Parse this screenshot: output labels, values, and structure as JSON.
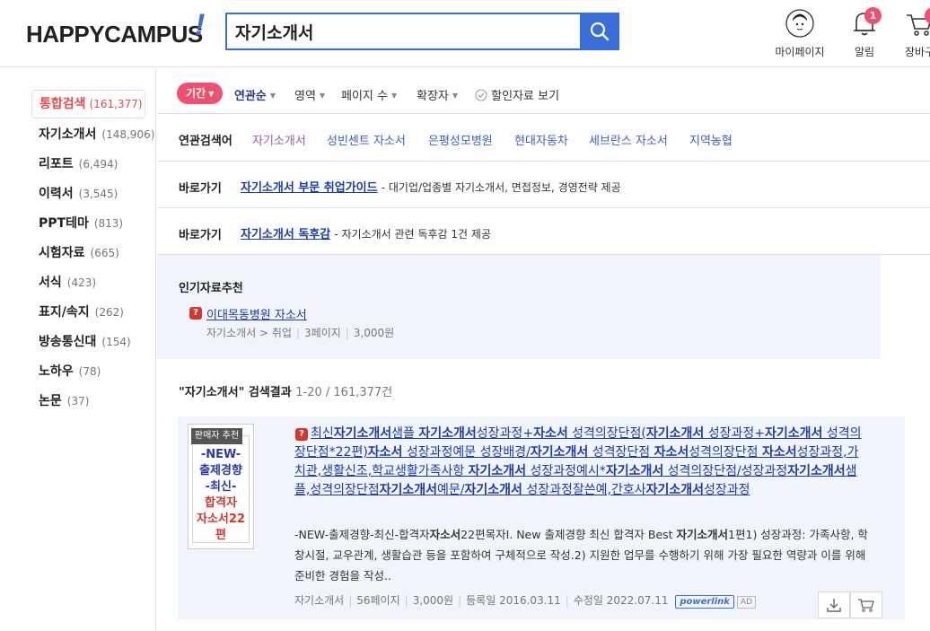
{
  "header": {
    "logo": "HAPPYCAMPUS",
    "logo_mark": "!",
    "search_value": "자기소개서",
    "mypage_label": "마이페이지",
    "alarm_label": "알림",
    "alarm_count": "1",
    "cart_label": "장바구"
  },
  "sidebar": {
    "items": [
      {
        "label": "통합검색",
        "count": "(161,377)"
      },
      {
        "label": "자기소개서",
        "count": "(148,906)"
      },
      {
        "label": "리포트",
        "count": "(6,494)"
      },
      {
        "label": "이력서",
        "count": "(3,545)"
      },
      {
        "label": "PPT테마",
        "count": "(813)"
      },
      {
        "label": "시험자료",
        "count": "(665)"
      },
      {
        "label": "서식",
        "count": "(423)"
      },
      {
        "label": "표지/속지",
        "count": "(262)"
      },
      {
        "label": "방송통신대",
        "count": "(154)"
      },
      {
        "label": "노하우",
        "count": "(78)"
      },
      {
        "label": "논문",
        "count": "(37)"
      }
    ]
  },
  "filters": {
    "period": "기간",
    "sort": "연관순",
    "area": "영역",
    "pages": "페이지 수",
    "ext": "확장자",
    "discount": "할인자료 보기"
  },
  "related": {
    "title": "연관검색어",
    "keywords": [
      "자기소개서",
      "성빈센트 자소서",
      "은평성모병원",
      "현대자동차",
      "세브란스 자소서",
      "지역농협"
    ]
  },
  "shortcut1": {
    "title": "바로가기",
    "link": "자기소개서 부문 취업가이드",
    "desc": "- 대기업/업종별 자기소개서, 면접정보, 경영전략 제공"
  },
  "shortcut2": {
    "title": "바로가기",
    "link": "자기소개서 독후감",
    "desc": "- 자기소개서 관련 독후감 1건 제공"
  },
  "popular": {
    "title": "인기자료추천",
    "item_title": "이대목동병원 자소서",
    "meta": [
      "자기소개서 > 취업",
      "3페이지",
      "3,000원"
    ]
  },
  "results": {
    "query": "\"자기소개서\" 검색결과",
    "range": "1-20 / 161,377건",
    "item": {
      "badge": "판매자 추천",
      "thumb_lines_blue": [
        "-NEW-",
        "출제경향",
        "-최신-"
      ],
      "thumb_lines_red": [
        "합격자",
        "자소서22편"
      ],
      "title_parts": [
        {
          "t": "최신",
          "b": false
        },
        {
          "t": "자기소개서",
          "b": true
        },
        {
          "t": "샘플 ",
          "b": false
        },
        {
          "t": "자기소개서",
          "b": true
        },
        {
          "t": "성장과정+",
          "b": false
        },
        {
          "t": "자소서",
          "b": true
        },
        {
          "t": " 성격의장단점(",
          "b": false
        },
        {
          "t": "자기소개서",
          "b": true
        },
        {
          "t": " 성장과정+",
          "b": false
        },
        {
          "t": "자기소개서",
          "b": true
        },
        {
          "t": " 성격의장단점*22편)",
          "b": false
        },
        {
          "t": "자소서",
          "b": true
        },
        {
          "t": " 성장과정예문 성장배경/",
          "b": false
        },
        {
          "t": "자기소개서",
          "b": true
        },
        {
          "t": " 성격장단점 ",
          "b": false
        },
        {
          "t": "자소서",
          "b": true
        },
        {
          "t": "성격의장단점 ",
          "b": false
        },
        {
          "t": "자소서",
          "b": true
        },
        {
          "t": "성장과정,가치관,생활신조,학교생활가족사항 ",
          "b": false
        },
        {
          "t": "자기소개서",
          "b": true
        },
        {
          "t": " 성장과정예시*",
          "b": false
        },
        {
          "t": "자기소개서",
          "b": true
        },
        {
          "t": " 성격의장단점/성장과정",
          "b": false
        },
        {
          "t": "자기소개서",
          "b": true
        },
        {
          "t": "샘플,성격의장단점",
          "b": false
        },
        {
          "t": "자기소개서",
          "b": true
        },
        {
          "t": "예문/",
          "b": false
        },
        {
          "t": "자기소개서",
          "b": true
        },
        {
          "t": " 성장과정잘쓴예,간호사",
          "b": false
        },
        {
          "t": "자기소개서",
          "b": true
        },
        {
          "t": "성장과정",
          "b": false
        }
      ],
      "desc_parts": [
        {
          "t": "-NEW-출제경향-최신-합격자",
          "b": false
        },
        {
          "t": "자소서",
          "b": true
        },
        {
          "t": "22편목자Ⅰ. New 출제경향 최신 합격자 Best ",
          "b": false
        },
        {
          "t": "자기소개서",
          "b": true
        },
        {
          "t": "1편1) 성장과정: 가족사항, 학창시절, 교우관계, 생활습관 등을 포함하여 구체적으로 작성.2) 지원한 업무를 수행하기 위해 가장 필요한 역량과 이를 위해 준비한 경험을 작성..",
          "b": false
        }
      ],
      "meta": [
        "자기소개서",
        "56페이지",
        "3,000원",
        "등록일 2016.03.11",
        "수정일 2022.07.11"
      ],
      "powerlink": "powerlink",
      "ad": "AD"
    }
  },
  "colors": {
    "accent": "#3b6fd8",
    "red": "#f0506e",
    "link": "#1a3bb0"
  }
}
